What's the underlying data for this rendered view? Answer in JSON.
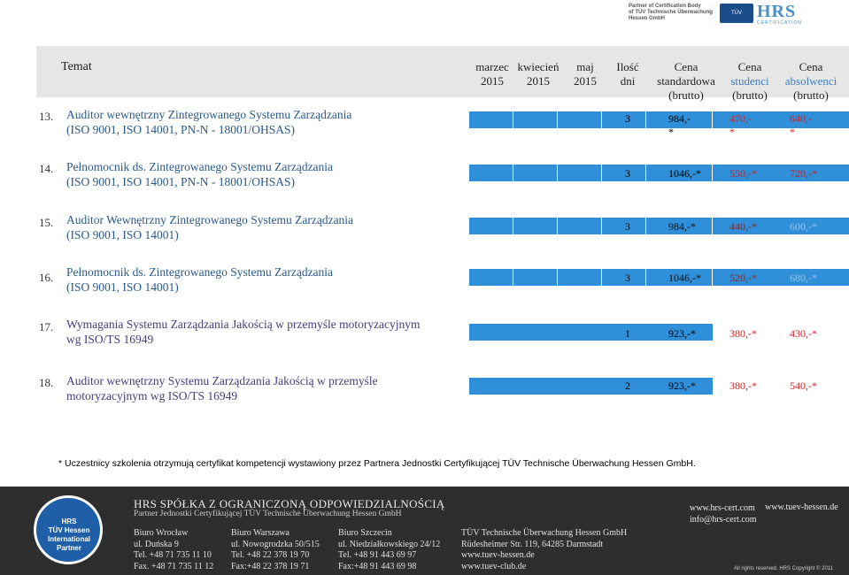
{
  "partner_logo": {
    "lines": [
      "Partner of Certification Body",
      "of TÜV Technische Überwachung",
      "Hessen GmbH"
    ],
    "hrs_text": "HRS",
    "hrs_sub": "CERTIFICATION"
  },
  "header": {
    "title": "Temat",
    "col_marzec": [
      "marzec",
      "2015"
    ],
    "col_kwiecien": [
      "kwiecień",
      "2015"
    ],
    "col_maj": [
      "maj",
      "2015"
    ],
    "col_dni": [
      "Ilość",
      "dni"
    ],
    "col_std": [
      "Cena",
      "standardowa",
      "(brutto)"
    ],
    "col_stu": [
      "Cena",
      "studenci",
      "(brutto)"
    ],
    "col_abs": [
      "Cena",
      "absolwenci",
      "(brutto)"
    ]
  },
  "rows": [
    {
      "num": "13.",
      "line1": "Auditor wewnętrzny Zintegrowanego Systemu Zarządzania",
      "line2": "(ISO 9001, ISO 14001, PN-N - 18001/OHSAS)",
      "dni": "3",
      "std": "984,-*",
      "stu": "470,-*",
      "abs": "640,-*"
    },
    {
      "num": "14.",
      "line1": "Pełnomocnik ds. Zintegrowanego Systemu Zarządzania",
      "line2": "(ISO 9001, ISO 14001, PN-N - 18001/OHSAS)",
      "dni": "3",
      "std": "1046,-*",
      "stu": "550,-*",
      "abs": "720,-*"
    },
    {
      "num": "15.",
      "line1": "Auditor Wewnętrzny Zintegrowanego Systemu Zarządzania",
      "line2": "(ISO 9001, ISO 14001)",
      "dni": "3",
      "std": "984,-*",
      "stu": "440,-*",
      "abs": "600,-*"
    },
    {
      "num": "16.",
      "line1": "Pełnomocnik ds. Zintegrowanego Systemu Zarządzania",
      "line2": "(ISO 9001, ISO 14001)",
      "dni": "3",
      "std": "1046,-*",
      "stu": "520,-*",
      "abs": "680,-*"
    },
    {
      "num": "17.",
      "line1": "Wymagania Systemu Zarządzania Jakością w przemyśle motoryzacyjnym",
      "line2": "wg ISO/TS 16949",
      "dni": "1",
      "std": "923,-*",
      "stu": "380,-*",
      "abs": "430,-*"
    },
    {
      "num": "18.",
      "line1": "Auditor wewnętrzny Systemu Zarządzania Jakością w przemyśle",
      "line2": "motoryzacyjnym wg ISO/TS 16949",
      "dni": "2",
      "std": "923,-*",
      "stu": "380,-*",
      "abs": "540,-*"
    }
  ],
  "footnote": "* Uczestnicy szkolenia otrzymują certyfikat kompetencji  wystawiony przez  Partnera Jednostki Certyfikującej TÜV Technische Überwachung Hessen GmbH.",
  "footer": {
    "badge": [
      "HRS",
      "TÜV Hessen",
      "International",
      "Partner"
    ],
    "company": "HRS SPÓŁKA Z OGRANICZONĄ ODPOWIEDZIALNOŚCIĄ",
    "partner": "Partner Jednostki Certyfikującej TÜV Technische Überwachung Hessen GmbH",
    "offices": [
      {
        "name": "Biuro Wrocław",
        "street": "ul. Duńska 9",
        "tel": "Tel. +48 71 735 11 10",
        "fax": "Fax. +48 71 735 11 12"
      },
      {
        "name": "Biuro Warszawa",
        "street": "ul. Nowogrodzka 50/515",
        "tel": "Tel. +48 22 378 19 70",
        "fax": "Fax:+48 22 378 19 71"
      },
      {
        "name": "Biuro Szczecin",
        "street": "ul. Niedziałkowskiego 24/12",
        "tel": "Tel. +48 91 443 69 97",
        "fax": "Fax:+48 91 443 69 98"
      },
      {
        "name": "TÜV Technische Überwachung Hessen GmbH",
        "street": "Rüdesheimer Str. 119, 64285 Darmstadt",
        "tel": "www.tuev-hessen.de",
        "fax": "www.tuev-club.de"
      }
    ],
    "web": "www.hrs-cert.com",
    "email": "info@hrs-cert.com",
    "tuv_web": "www.tuev-hessen.de",
    "copyright": "All rights reserved. HRS Copyright © 2011"
  },
  "colors": {
    "header_bg": "#e6e6e6",
    "bar_blue": "#2f8fd8",
    "footer_bg": "#2e2e2e",
    "price_red": "#c22"
  }
}
